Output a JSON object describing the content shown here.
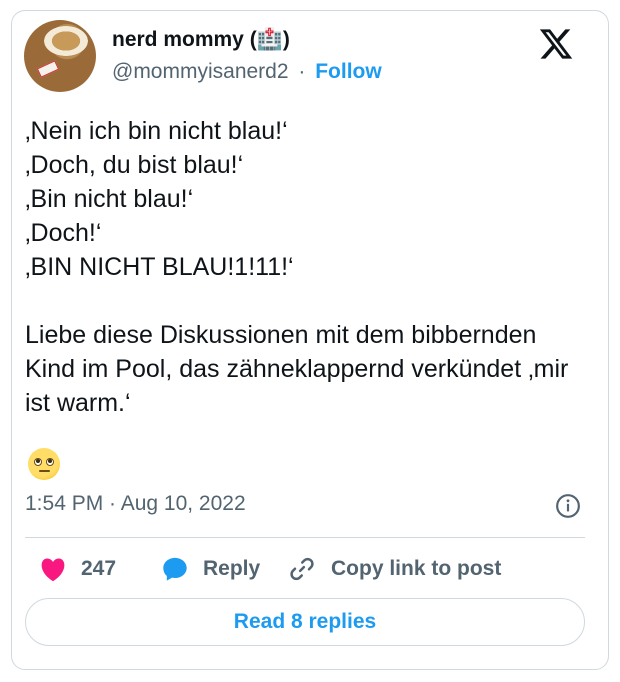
{
  "tweet": {
    "author": {
      "name": "nerd mommy (🏥)",
      "handle": "@mommyisanerd2",
      "separator": "·",
      "follow_label": "Follow"
    },
    "text": "‚Nein ich bin nicht blau!‘\n‚Doch, du bist blau!‘\n‚Bin nicht blau!‘\n‚Doch!‘\n‚BIN NICHT BLAU!1!11!‘\n\nLiebe diese Diskussionen mit dem bibbernden Kind im Pool, das zähneklappernd verkündet ‚mir ist warm.‘",
    "emoji": "face-with-rolling-eyes",
    "timestamp": "1:54 PM · Aug 10, 2022",
    "likes": "247",
    "reply_label": "Reply",
    "copy_link_label": "Copy link to post",
    "read_replies_label": "Read 8 replies"
  },
  "icons": {
    "logo": "x-logo",
    "info": "info-icon",
    "like": "heart-icon",
    "reply": "speech-bubble-icon",
    "copy": "link-icon"
  },
  "colors": {
    "accent": "#1d9bf0",
    "like": "#f91880",
    "muted": "#536471",
    "border": "#cfd9de"
  }
}
